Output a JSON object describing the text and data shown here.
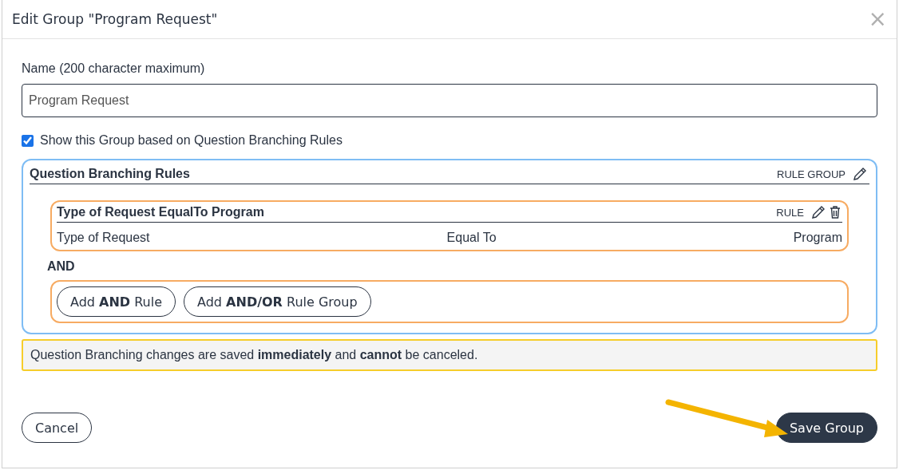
{
  "dialog": {
    "title": "Edit Group \"Program Request\"",
    "close": "×"
  },
  "name_field": {
    "label": "Name (200 character maximum)",
    "value": "Program Request"
  },
  "show_group": {
    "label": "Show this Group based on Question Branching Rules",
    "checked": true
  },
  "rule_group": {
    "title": "Question Branching Rules",
    "tag": "RULE GROUP",
    "rules": [
      {
        "title": "Type of Request EqualTo Program",
        "tag": "RULE",
        "field": "Type of Request",
        "operator": "Equal To",
        "value": "Program"
      }
    ],
    "connector": "AND",
    "buttons": [
      "Add **AND** Rule",
      "Add **AND/OR** Rule Group"
    ]
  },
  "notice": "Question Branching changes are saved **immediately** and **cannot** be canceled.",
  "footer": {
    "cancel": "Cancel",
    "save": "Save Group"
  }
}
